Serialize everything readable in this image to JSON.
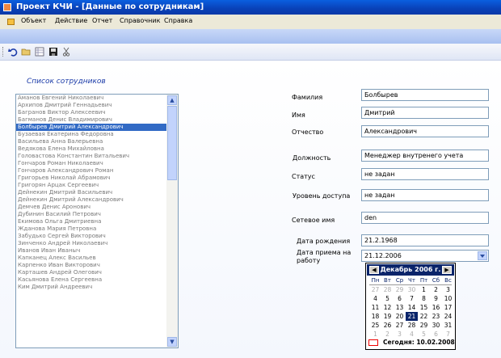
{
  "window": {
    "title": "Проект КЧИ - [Данные по сотрудникам]"
  },
  "menu": [
    "Объект",
    "Действие",
    "Отчет",
    "Справочник",
    "Справка"
  ],
  "toolbar_icons": [
    "undo-icon",
    "open-folder-icon",
    "grid-icon",
    "save-icon",
    "cut-icon"
  ],
  "list": {
    "title": "Список сотрудников",
    "items": [
      "Аманов Евгений Николаевич",
      "Архипов Дмитрий Геннадьевич",
      "Багранов Виктор Алексеевич",
      "Багманов Денис Владимирович",
      "Болбырев Дмитрий Александрович",
      "Бузаевая Екатерина Федоровна",
      "Васильева Анна Валерьевна",
      "Ведякова Елена Михайловна",
      "Головастова Константин Витальевич",
      "Гончаров Роман Николаевич",
      "Гончаров Александрович Роман",
      "Григорьев Николай Абрамович",
      "Григорян Арцак Сергеевич",
      "Дейнекин Дмитрий Васильевич",
      "Дейнекин Дмитрий Александрович",
      "Демчев Денис Аронович",
      "Дубинин Василий Петрович",
      "Екимова Ольга Дмитриевна",
      "Жданова Мария Петровна",
      "Забудько Сергей Викторович",
      "Зинченко Андрей Николаевич",
      "Иванов Иван Иваныч",
      "Капканец Алекс Васильев",
      "Карпенко Иван Викторович",
      "Карташев Андрей Олегович",
      "Касьянова Елена Сергеевна",
      "Ким Дмитрий Андреевич"
    ],
    "selected_index": 4
  },
  "form": {
    "surname_label": "Фамилия",
    "surname": "Болбырев",
    "name_label": "Имя",
    "name": "Дмитрий",
    "patronymic_label": "Отчество",
    "patronymic": "Александрович",
    "position_label": "Должность",
    "position": "Менеджер внутренего учета",
    "status_label": "Статус",
    "status": "не задан",
    "access_label": "Уровень доступа",
    "access": "не задан",
    "netname_label": "Сетевое имя",
    "netname": "den",
    "birth_label": "Дата рождения",
    "birth": "21.2.1968",
    "hire_label_1": "Дата приема на",
    "hire_label_2": "работу",
    "hire": "21.12.2006"
  },
  "calendar": {
    "month_label": "Декабрь 2006 г.",
    "weekdays": [
      "Пн",
      "Вт",
      "Ср",
      "Чт",
      "Пт",
      "Сб",
      "Вс"
    ],
    "weeks": [
      [
        "27",
        "28",
        "29",
        "30",
        "1",
        "2",
        "3"
      ],
      [
        "4",
        "5",
        "6",
        "7",
        "8",
        "9",
        "10"
      ],
      [
        "11",
        "12",
        "13",
        "14",
        "15",
        "16",
        "17"
      ],
      [
        "18",
        "19",
        "20",
        "21",
        "22",
        "23",
        "24"
      ],
      [
        "25",
        "26",
        "27",
        "28",
        "29",
        "30",
        "31"
      ],
      [
        "1",
        "2",
        "3",
        "4",
        "5",
        "6",
        "7"
      ]
    ],
    "selected_day": "21",
    "today_text": "Сегодня: 10.02.2008"
  },
  "colors": {
    "titlebar": "#0A41B7",
    "selection": "#316AC5",
    "calendar_header": "#0A246A"
  }
}
